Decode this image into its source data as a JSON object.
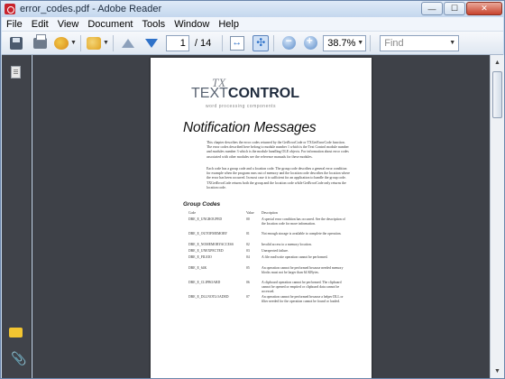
{
  "window": {
    "title": "error_codes.pdf - Adobe Reader",
    "minimize": "—",
    "maximize": "☐",
    "close": "✕"
  },
  "menu": {
    "items": [
      {
        "label": "File"
      },
      {
        "label": "Edit"
      },
      {
        "label": "View"
      },
      {
        "label": "Document"
      },
      {
        "label": "Tools"
      },
      {
        "label": "Window"
      },
      {
        "label": "Help"
      }
    ]
  },
  "toolbar": {
    "page_current": "1",
    "page_total": "/ 14",
    "zoom": "38.7%",
    "find_placeholder": "Find",
    "dropdown_arrow": "▼"
  },
  "document": {
    "logo": {
      "tx": "TX",
      "text": "TEXT",
      "control": "CONTROL",
      "sub": "word processing components"
    },
    "title": "Notification Messages",
    "para1": "This chapter describes the error codes returned by the GetErrorCode or TXGetErrorCode function. The error codes described here belong to module number 1 which is the Text Control module number and modules number 3 which is the module handling OLE objects. For information about error codes associated with other modules see the reference manuals for these modules.",
    "para2": "Each code has a group code and a location code. The group code describes a general error condition for example when the program runs out of memory and the location code describes the location where the error has been occurred. In most case it is sufficient for an application to handle the group code. TXGetErrorCode returns both the group and the location code while GetErrorCode only returns the location code.",
    "subheading": "Group Codes",
    "table": {
      "headers": {
        "code": "Code",
        "value": "Value",
        "description": "Description"
      },
      "rows": [
        {
          "code": "DRE_E_UNGROUPED",
          "value": "00",
          "description": "A special error condition has occurred. See the description of the location code for more information."
        },
        {
          "code": "DRE_E_OUTOFMEMORY",
          "value": "01",
          "description": "Not enough storage is available to complete the operation."
        },
        {
          "code": "DRE_E_NOMEMORYACCESS",
          "value": "02",
          "description": "Invalid access to a memory location."
        },
        {
          "code": "DRE_E_UNEXPECTED",
          "value": "03",
          "description": "Unexpected failure."
        },
        {
          "code": "DRE_E_FILEIO",
          "value": "04",
          "description": "A file read/write operation cannot be performed."
        },
        {
          "code": "DRE_E_64K",
          "value": "05",
          "description": "An operation cannot be performed because needed memory blocks must not be larger than 64 KBytes."
        },
        {
          "code": "DRE_E_CLIPBOARD",
          "value": "06",
          "description": "A clipboard operation cannot be performed. The clipboard cannot be opened or emptied or clipboard data cannot be accessed."
        },
        {
          "code": "DRE_E_DLLNOTLOADED",
          "value": "07",
          "description": "An operation cannot be performed because a helper DLL or filter needed for the operation cannot be found or loaded."
        }
      ]
    }
  }
}
